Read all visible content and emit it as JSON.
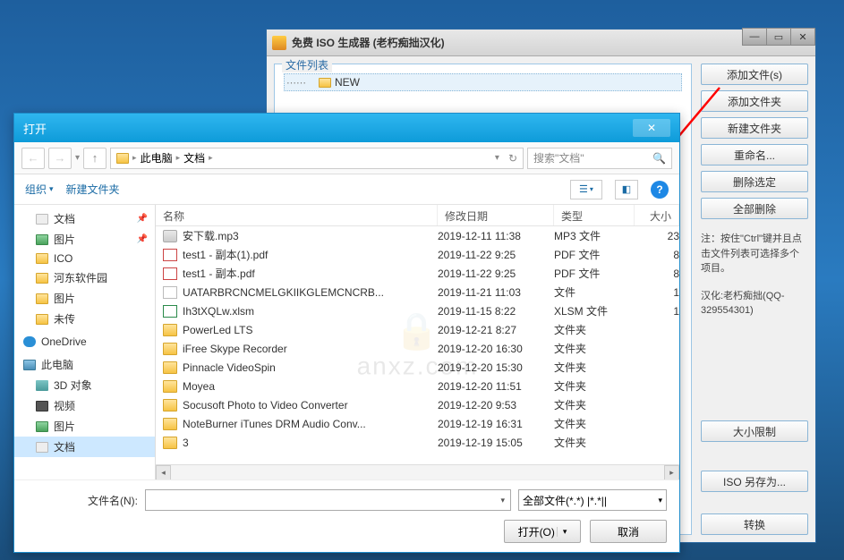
{
  "iso_app": {
    "title": "免费 ISO 生成器 (老朽痴拙汉化)",
    "panel_label": "文件列表",
    "tree_item": "NEW",
    "buttons": {
      "add_files": "添加文件(s)",
      "add_folder": "添加文件夹",
      "new_folder": "新建文件夹",
      "rename": "重命名...",
      "delete_sel": "删除选定",
      "delete_all": "全部删除",
      "size_limit": "大小限制",
      "iso_save_as": "ISO 另存为...",
      "convert": "转换"
    },
    "note1": "注：按住\"Ctrl\"键并且点击文件列表可选择多个项目。",
    "note2": "汉化:老朽痴拙(QQ-329554301)"
  },
  "open_dialog": {
    "title": "打开",
    "breadcrumb": {
      "root": "此电脑",
      "current": "文档"
    },
    "search_placeholder": "搜索\"文档\"",
    "toolbar": {
      "organize": "组织",
      "new_folder": "新建文件夹"
    },
    "sidebar": {
      "quick": [
        "文档",
        "图片",
        "ICO",
        "河东软件园",
        "图片",
        "未传"
      ],
      "onedrive": "OneDrive",
      "thispc": "此电脑",
      "pc_items": [
        "3D 对象",
        "视频",
        "图片",
        "文档"
      ]
    },
    "columns": {
      "name": "名称",
      "date": "修改日期",
      "type": "类型",
      "size": "大小"
    },
    "rows": [
      {
        "icon": "mp3",
        "name": "安下载.mp3",
        "date": "2019-12-11 11:38",
        "type": "MP3 文件",
        "size": "23"
      },
      {
        "icon": "pdf",
        "name": "test1 - 副本(1).pdf",
        "date": "2019-11-22 9:25",
        "type": "PDF 文件",
        "size": "8"
      },
      {
        "icon": "pdf",
        "name": "test1 - 副本.pdf",
        "date": "2019-11-22 9:25",
        "type": "PDF 文件",
        "size": "8"
      },
      {
        "icon": "file",
        "name": "UATARBRCNCMELGKIIKGLEMCNCRB...",
        "date": "2019-11-21 11:03",
        "type": "文件",
        "size": "1"
      },
      {
        "icon": "xls",
        "name": "Ih3tXQLw.xlsm",
        "date": "2019-11-15 8:22",
        "type": "XLSM 文件",
        "size": "1"
      },
      {
        "icon": "folder",
        "name": "PowerLed LTS",
        "date": "2019-12-21 8:27",
        "type": "文件夹",
        "size": ""
      },
      {
        "icon": "folder",
        "name": "iFree Skype Recorder",
        "date": "2019-12-20 16:30",
        "type": "文件夹",
        "size": ""
      },
      {
        "icon": "folder",
        "name": "Pinnacle VideoSpin",
        "date": "2019-12-20 15:30",
        "type": "文件夹",
        "size": ""
      },
      {
        "icon": "folder",
        "name": "Moyea",
        "date": "2019-12-20 11:51",
        "type": "文件夹",
        "size": ""
      },
      {
        "icon": "folder",
        "name": "Socusoft Photo to Video Converter",
        "date": "2019-12-20 9:53",
        "type": "文件夹",
        "size": ""
      },
      {
        "icon": "folder",
        "name": "NoteBurner iTunes DRM Audio Conv...",
        "date": "2019-12-19 16:31",
        "type": "文件夹",
        "size": ""
      },
      {
        "icon": "folder",
        "name": "3",
        "date": "2019-12-19 15:05",
        "type": "文件夹",
        "size": ""
      }
    ],
    "filename_label": "文件名(N):",
    "filter": "全部文件(*.*)  |*.*||",
    "open_btn": "打开(O)",
    "cancel_btn": "取消"
  }
}
